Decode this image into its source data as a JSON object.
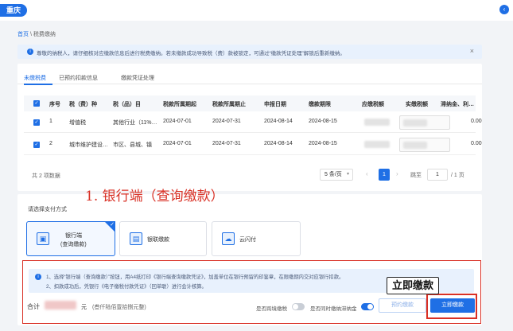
{
  "topbar": {
    "city": "重庆",
    "chevron": "‹"
  },
  "breadcrumb": {
    "home": "首页",
    "sep": " \\ ",
    "current": "税费缴纳"
  },
  "notice": {
    "icon": "i",
    "text": "尊敬的纳税人，请仔细核对应缴款信息后进行税费缴纳。若未缴款成功导致税（费）款被锁定，可通过“缴款凭证处理”解锁后重新缴纳。",
    "close": "×"
  },
  "tabs": [
    {
      "label": "未缴税费"
    },
    {
      "label": "已预约扣款信息"
    },
    {
      "label": "缴款凭证处理"
    }
  ],
  "table": {
    "headers": [
      "序号",
      "税（费）种",
      "税（品）目",
      "税款所属期起",
      "税款所属期止",
      "申报日期",
      "缴款期限",
      "应缴税额",
      "实缴税额",
      "滞纳金、利…"
    ],
    "rows": [
      {
        "no": "1",
        "tax": "增值税",
        "item": "其他行业（11%…",
        "start": "2024-07-01",
        "end": "2024-07-31",
        "declared": "2024-08-14",
        "deadline": "2024-08-15",
        "late_fee": "0.00"
      },
      {
        "no": "2",
        "tax": "城市维护建设…",
        "item": "市区、县城、镇",
        "start": "2024-07-01",
        "end": "2024-07-31",
        "declared": "2024-08-14",
        "deadline": "2024-08-15",
        "late_fee": "0.00"
      }
    ]
  },
  "pager": {
    "total": "共 2 项数据",
    "page_size": "5 条/页",
    "prev": "‹",
    "current": "1",
    "next": "›",
    "goto_label": "跳至",
    "goto_value": "1",
    "total_pages": "/ 1 页"
  },
  "annotation_top": "1. 银行端（查询缴款）",
  "payment": {
    "label": "请选择支付方式",
    "methods": [
      {
        "label": "银行端",
        "label2": "(查询缴款)",
        "icon": "▣"
      },
      {
        "label": "银联缴款",
        "icon": "▤"
      },
      {
        "label": "云闪付",
        "icon": "☁"
      }
    ]
  },
  "info": {
    "icon": "i",
    "line1": "1、选择“银行端（查询缴款）”按钮，用A4纸打印《银行端查询缴款凭证》，加盖单位在银行预留的印鉴章，在限缴期内交对应银行扣款。",
    "line2": "2、扣款成功后，凭银行《电子缴税付款凭证》（回单联）进行会计核算。"
  },
  "total": {
    "label": "合计",
    "unit": "元",
    "caption": "(叁仟陆佰壹拾捌元整)"
  },
  "switches": [
    {
      "label": "是否跨境缴税",
      "on": false
    },
    {
      "label": "是否同时缴纳滞纳金",
      "on": true
    }
  ],
  "buttons": {
    "pre_pay": "预约缴款",
    "pay_now": "立即缴款"
  },
  "tooltip": "立即缴款",
  "colors": {
    "primary": "#1f6fe5",
    "annotation": "#d93025"
  }
}
